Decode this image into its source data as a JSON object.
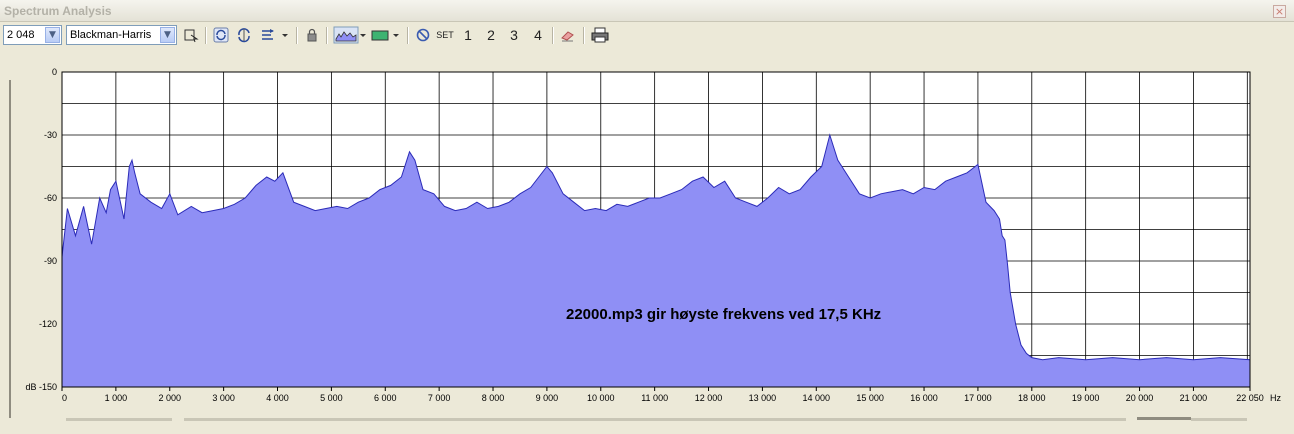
{
  "window": {
    "title": "Spectrum Analysis",
    "close_glyph": "×"
  },
  "toolbar": {
    "size_value": "2 048",
    "window_value": "Blackman-Harris",
    "set_label": "SET",
    "preset_1": "1",
    "preset_2": "2",
    "preset_3": "3",
    "preset_4": "4",
    "colors": {
      "plot_color": "#3cb371",
      "fill_color": "#8f8ff5"
    }
  },
  "icons": [
    "export-icon",
    "refresh-icon",
    "refresh-scan-icon",
    "sort-icon",
    "lock-icon",
    "plot-style-icon",
    "color-swatch-icon",
    "block-icon",
    "eraser-icon",
    "print-icon"
  ],
  "chart_data": {
    "type": "area",
    "annotation": "22000.mp3 gir høyste frekvens ved 17,5 KHz",
    "xlabel": "Hz",
    "ylabel": "dB",
    "xlim": [
      0,
      22050
    ],
    "ylim": [
      -150,
      0
    ],
    "x_ticks": [
      0,
      1000,
      2000,
      3000,
      4000,
      5000,
      6000,
      7000,
      8000,
      9000,
      10000,
      11000,
      12000,
      13000,
      14000,
      15000,
      16000,
      17000,
      18000,
      19000,
      20000,
      21000,
      22050
    ],
    "x_tick_labels": [
      "0",
      "1 000",
      "2 000",
      "3 000",
      "4 000",
      "5 000",
      "6 000",
      "7 000",
      "8 000",
      "9 000",
      "10 000",
      "11 000",
      "12 000",
      "13 000",
      "14 000",
      "15 000",
      "16 000",
      "17 000",
      "18 000",
      "19 000",
      "20 000",
      "21 000",
      "22 050"
    ],
    "y_ticks": [
      0,
      -30,
      -60,
      -90,
      -120,
      -150
    ],
    "y_tick_labels": [
      "0",
      "-30",
      "-60",
      "-90",
      "-120",
      "dB -150"
    ],
    "grid": true,
    "series": [
      {
        "x": [
          0,
          100,
          250,
          400,
          550,
          700,
          820,
          900,
          1000,
          1150,
          1250,
          1300,
          1350,
          1450,
          1650,
          1850,
          2000,
          2150,
          2400,
          2600,
          2800,
          3000,
          3200,
          3400,
          3600,
          3800,
          3950,
          4100,
          4300,
          4500,
          4700,
          4900,
          5100,
          5300,
          5500,
          5700,
          5900,
          6100,
          6300,
          6450,
          6550,
          6700,
          6900,
          7100,
          7300,
          7500,
          7700,
          7900,
          8100,
          8300,
          8500,
          8700,
          8850,
          9000,
          9100,
          9300,
          9500,
          9700,
          9900,
          10100,
          10300,
          10500,
          10700,
          10900,
          11100,
          11300,
          11500,
          11700,
          11900,
          12100,
          12300,
          12500,
          12700,
          12900,
          13100,
          13300,
          13500,
          13700,
          13900,
          14100,
          14250,
          14400,
          14600,
          14800,
          15000,
          15200,
          15400,
          15600,
          15800,
          16000,
          16200,
          16400,
          16600,
          16800,
          16900,
          17000,
          17150,
          17300,
          17400,
          17450,
          17500,
          17550,
          17600,
          17700,
          17800,
          17900,
          18000,
          18200,
          18500,
          19000,
          19500,
          20000,
          20500,
          21000,
          21500,
          22050
        ],
        "values": [
          -88,
          -65,
          -78,
          -64,
          -82,
          -60,
          -67,
          -56,
          -52,
          -70,
          -45,
          -42,
          -48,
          -58,
          -62,
          -65,
          -58,
          -68,
          -64,
          -67,
          -66,
          -65,
          -63,
          -60,
          -54,
          -50,
          -52,
          -48,
          -62,
          -64,
          -66,
          -65,
          -64,
          -65,
          -62,
          -60,
          -56,
          -54,
          -50,
          -38,
          -42,
          -56,
          -58,
          -64,
          -66,
          -65,
          -62,
          -65,
          -64,
          -62,
          -58,
          -55,
          -50,
          -45,
          -48,
          -58,
          -62,
          -66,
          -65,
          -66,
          -63,
          -64,
          -62,
          -60,
          -60,
          -58,
          -56,
          -52,
          -50,
          -55,
          -52,
          -60,
          -62,
          -64,
          -60,
          -55,
          -58,
          -56,
          -50,
          -45,
          -30,
          -42,
          -50,
          -58,
          -60,
          -58,
          -57,
          -56,
          -58,
          -55,
          -56,
          -52,
          -50,
          -48,
          -46,
          -44,
          -62,
          -66,
          -70,
          -78,
          -80,
          -92,
          -105,
          -120,
          -130,
          -134,
          -136,
          -137,
          -136,
          -137,
          -136,
          -137,
          -136,
          -137,
          -136,
          -137
        ]
      }
    ]
  }
}
